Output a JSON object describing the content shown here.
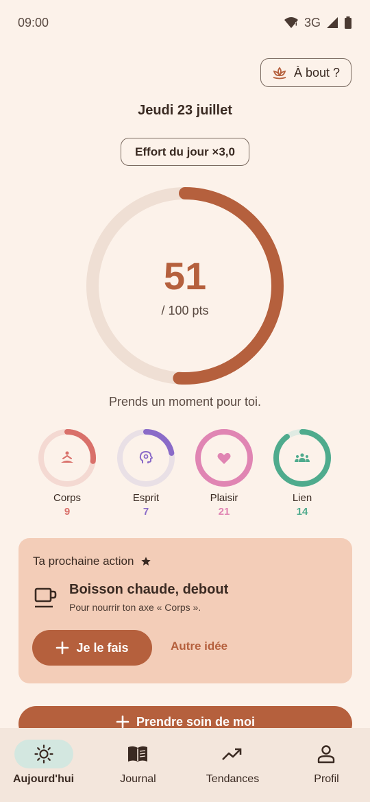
{
  "status": {
    "time": "09:00",
    "network": "3G"
  },
  "header": {
    "abort_label": "À bout ?",
    "date": "Jeudi 23 juillet",
    "effort_label": "Effort du jour ×3,0"
  },
  "score": {
    "value": "51",
    "max_label": "/ 100 pts",
    "progress": 0.51
  },
  "encouragement": "Prends un moment pour toi.",
  "axes": [
    {
      "label": "Corps",
      "value": "9",
      "progress": 0.27,
      "color": "#d9706a",
      "track": "#f4d9d2",
      "icon": "meditation-icon"
    },
    {
      "label": "Esprit",
      "value": "7",
      "progress": 0.22,
      "color": "#8a6bc8",
      "track": "#e9e0e6",
      "icon": "brain-icon"
    },
    {
      "label": "Plaisir",
      "value": "21",
      "progress": 1.0,
      "color": "#e085b3",
      "track": "#f4d6e2",
      "icon": "heart-icon"
    },
    {
      "label": "Lien",
      "value": "14",
      "progress": 0.9,
      "color": "#4fab8d",
      "track": "#e0ebe3",
      "icon": "group-icon"
    }
  ],
  "next_action": {
    "heading": "Ta prochaine action",
    "title": "Boisson chaude, debout",
    "subtitle": "Pour nourrir ton axe « Corps ».",
    "do_label": "Je le fais",
    "other_label": "Autre idée"
  },
  "care_button": "Prendre soin de moi",
  "nav": [
    {
      "label": "Aujourd'hui",
      "icon": "sun-icon",
      "active": true
    },
    {
      "label": "Journal",
      "icon": "book-icon",
      "active": false
    },
    {
      "label": "Tendances",
      "icon": "trending-icon",
      "active": false
    },
    {
      "label": "Profil",
      "icon": "person-icon",
      "active": false
    }
  ],
  "colors": {
    "accent": "#b5603d",
    "background": "#fcf2ea",
    "card": "#f3cdb8"
  }
}
